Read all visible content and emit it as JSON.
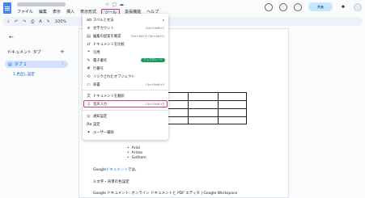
{
  "menubar": {
    "items": [
      "ファイル",
      "編集",
      "表示",
      "挿入",
      "表示形式",
      "ツール",
      "拡張機能",
      "ヘルプ"
    ],
    "active_index": 5
  },
  "header": {
    "share_label": "共有"
  },
  "toolbar": {
    "zoom": "100%"
  },
  "sidebar": {
    "tabs_title": "ドキュメント タブ",
    "tab_label": "タブ 1",
    "heading_item": "1.見出し設定"
  },
  "tools_menu": {
    "items": [
      {
        "icon": "spellcheck-icon",
        "glyph": "ab",
        "label": "スペルと文法",
        "shortcut": "",
        "arrow": true
      },
      {
        "icon": "word-count-icon",
        "glyph": "≡",
        "label": "文字カウント",
        "shortcut": "Ctrl+Shift+C"
      },
      {
        "icon": "review-icon",
        "glyph": "▤",
        "label": "編集の提案を確認",
        "shortcut": "Ctrl+Alt+O Ctrl+Alt+U"
      },
      {
        "icon": "compare-icon",
        "glyph": "⇄",
        "label": "ドキュメントを比較",
        "shortcut": ""
      },
      {
        "icon": "citations-icon",
        "glyph": "❝",
        "label": "引用",
        "shortcut": ""
      },
      {
        "icon": "esignature-icon",
        "glyph": "✎",
        "label": "電子署名",
        "badge": "アップグレード"
      },
      {
        "icon": "line-numbers-icon",
        "glyph": "#",
        "label": "行番号",
        "shortcut": ""
      },
      {
        "icon": "linked-objects-icon",
        "glyph": "⟲",
        "label": "リンクされたオブジェクト",
        "shortcut": ""
      },
      {
        "icon": "dictionary-icon",
        "glyph": "▭",
        "label": "辞書",
        "shortcut": "Ctrl+Shift+Y"
      },
      {
        "icon": "translate-icon",
        "glyph": "文",
        "label": "ドキュメントを翻訳",
        "shortcut": ""
      },
      {
        "icon": "voice-typing-icon",
        "glyph": "♫",
        "label": "音声入力",
        "shortcut": "Ctrl+Shift+S"
      },
      {
        "icon": "notifications-icon",
        "glyph": "◎",
        "label": "通知設定",
        "shortcut": ""
      },
      {
        "icon": "settings-icon",
        "glyph": "Aa",
        "label": "設定",
        "shortcut": ""
      },
      {
        "icon": "accessibility-icon",
        "glyph": "✦",
        "label": "ユーザー補助",
        "shortcut": ""
      }
    ]
  },
  "document": {
    "bullets": [
      "Arial",
      "Arimo",
      "Gotham"
    ],
    "line1_prefix": "Google",
    "line1_link": "ドキュメント",
    "line1_suffix": "では、",
    "line2": "3.文字・背景の色設定",
    "line3": "Google ドキュメント: オンライン ドキュメントと PDF エディタ | Google Workspace"
  }
}
